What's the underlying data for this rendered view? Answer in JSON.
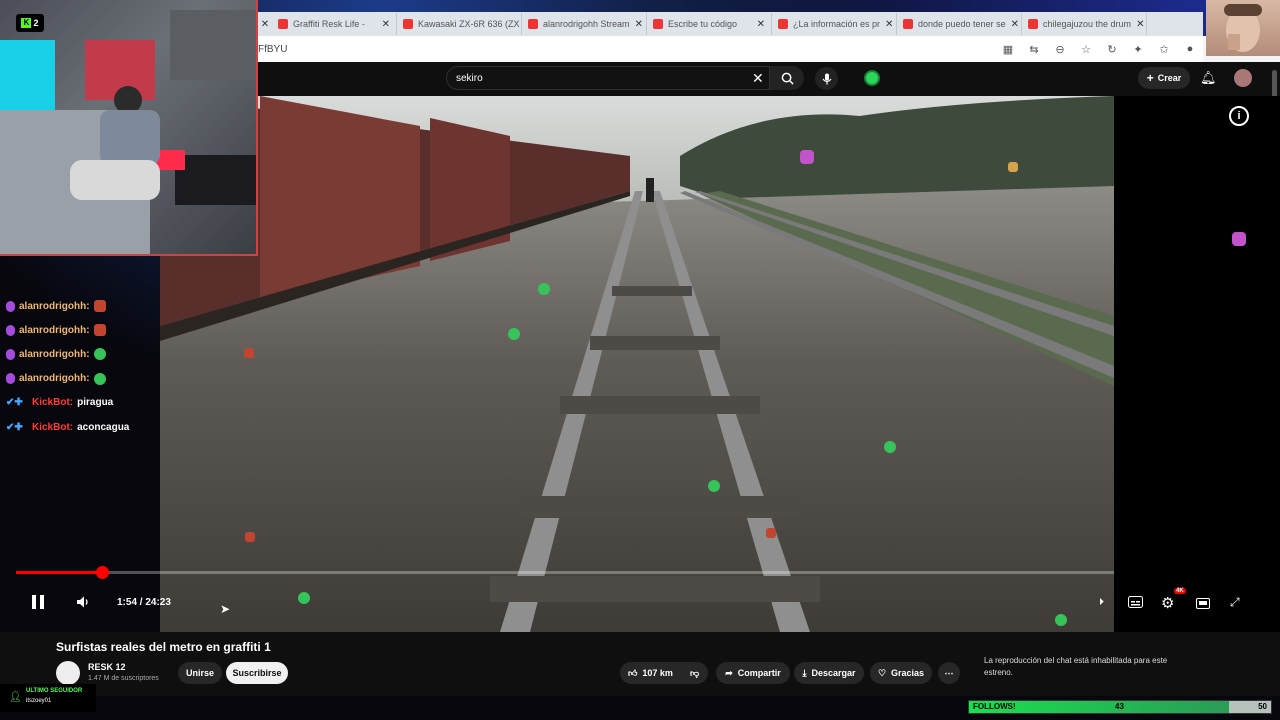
{
  "browser": {
    "tabs": [
      {
        "label": "Graffiti Resk Life -"
      },
      {
        "label": "Kawasaki ZX-6R 636 (ZX"
      },
      {
        "label": "alanrodrigohh Stream"
      },
      {
        "label": "Escribe tu código"
      },
      {
        "label": "¿La información es pr"
      },
      {
        "label": "donde puedo tener se"
      },
      {
        "label": "chilegajuzou the drum"
      }
    ],
    "address_fragment": "FfBYU"
  },
  "youtube": {
    "search_value": "sekiro",
    "create_label": "Crear",
    "video_title": "Surfistas reales del metro en graffiti 1",
    "channel_name": "RESK 12",
    "channel_subs": "1.47 M de suscriptores",
    "join_label": "Unirse",
    "subscribe_label": "Suscribirse",
    "likes": "107 km",
    "share_label": "Compartir",
    "download_label": "Descargar",
    "thanks_label": "Gracias",
    "chat_disabled_text": "La reproducción del chat está inhabilitada para este estreno.",
    "time_display": "1:54 / 24:23",
    "progress": 0.0779,
    "hd_badge": "4K"
  },
  "stream": {
    "viewer_count": "2",
    "chat": [
      {
        "user": "alanrodrigohh:",
        "message": "",
        "emote": "red",
        "type": "sub"
      },
      {
        "user": "alanrodrigohh:",
        "message": "",
        "emote": "red",
        "type": "sub"
      },
      {
        "user": "alanrodrigohh:",
        "message": "",
        "emote": "green",
        "type": "sub"
      },
      {
        "user": "alanrodrigohh:",
        "message": "",
        "emote": "green",
        "type": "sub"
      },
      {
        "user": "KickBot:",
        "message": "piragua",
        "emote": "",
        "type": "bot"
      },
      {
        "user": "KickBot:",
        "message": "aconcagua",
        "emote": "",
        "type": "bot"
      }
    ],
    "last_follower_label": "ULTIMO SEGUIDOR",
    "last_follower_name": "itszoey01",
    "follows_label": "FOLLOWS!",
    "follows_current": "43",
    "follows_goal": "50",
    "follows_fraction": 0.86
  }
}
